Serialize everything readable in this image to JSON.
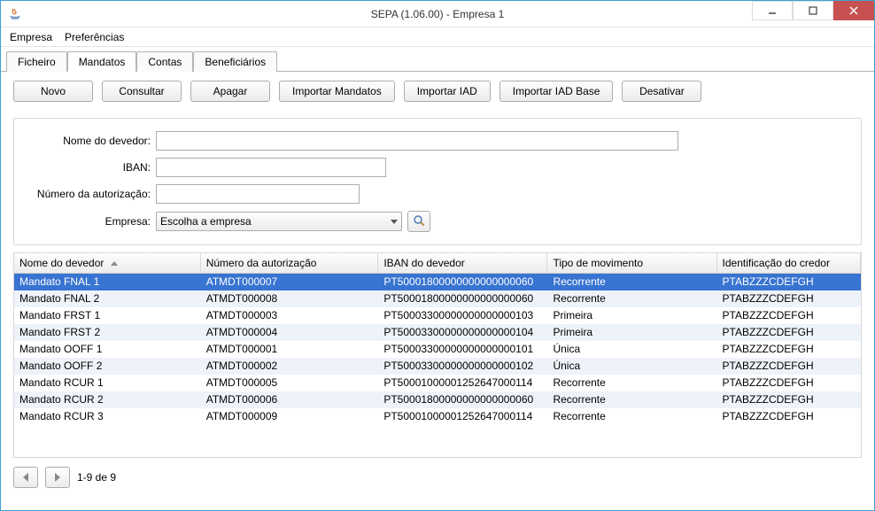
{
  "window": {
    "title": "SEPA  (1.06.00) - Empresa 1"
  },
  "menubar": {
    "empresa": "Empresa",
    "preferencias": "Preferências"
  },
  "tabs": {
    "ficheiro": "Ficheiro",
    "mandatos": "Mandatos",
    "contas": "Contas",
    "beneficiarios": "Beneficiários"
  },
  "toolbar": {
    "novo": "Novo",
    "consultar": "Consultar",
    "apagar": "Apagar",
    "importar_mandatos": "Importar Mandatos",
    "importar_iad": "Importar IAD",
    "importar_iad_base": "Importar IAD Base",
    "desativar": "Desativar"
  },
  "filters": {
    "nome_label": "Nome do devedor:",
    "iban_label": "IBAN:",
    "numero_label": "Número da autorização:",
    "empresa_label": "Empresa:",
    "empresa_placeholder": "Escolha a empresa",
    "nome_value": "",
    "iban_value": "",
    "numero_value": ""
  },
  "table": {
    "headers": {
      "nome": "Nome do devedor",
      "numero": "Número da autorização",
      "iban": "IBAN do devedor",
      "tipo": "Tipo de movimento",
      "credor": "Identificação do credor"
    },
    "rows": [
      {
        "nome": "Mandato FNAL 1",
        "numero": "ATMDT000007",
        "iban": "PT50001800000000000000060",
        "tipo": "Recorrente",
        "credor": "PTABZZZCDEFGH"
      },
      {
        "nome": "Mandato FNAL 2",
        "numero": "ATMDT000008",
        "iban": "PT50001800000000000000060",
        "tipo": "Recorrente",
        "credor": "PTABZZZCDEFGH"
      },
      {
        "nome": "Mandato FRST 1",
        "numero": "ATMDT000003",
        "iban": "PT50003300000000000000103",
        "tipo": "Primeira",
        "credor": "PTABZZZCDEFGH"
      },
      {
        "nome": "Mandato FRST 2",
        "numero": "ATMDT000004",
        "iban": "PT50003300000000000000104",
        "tipo": "Primeira",
        "credor": "PTABZZZCDEFGH"
      },
      {
        "nome": "Mandato OOFF 1",
        "numero": "ATMDT000001",
        "iban": "PT50003300000000000000101",
        "tipo": "Única",
        "credor": "PTABZZZCDEFGH"
      },
      {
        "nome": "Mandato OOFF 2",
        "numero": "ATMDT000002",
        "iban": "PT50003300000000000000102",
        "tipo": "Única",
        "credor": "PTABZZZCDEFGH"
      },
      {
        "nome": "Mandato RCUR 1",
        "numero": "ATMDT000005",
        "iban": "PT50001000001252647000114",
        "tipo": "Recorrente",
        "credor": "PTABZZZCDEFGH"
      },
      {
        "nome": "Mandato RCUR 2",
        "numero": "ATMDT000006",
        "iban": "PT50001800000000000000060",
        "tipo": "Recorrente",
        "credor": "PTABZZZCDEFGH"
      },
      {
        "nome": "Mandato RCUR 3",
        "numero": "ATMDT000009",
        "iban": "PT50001000001252647000114",
        "tipo": "Recorrente",
        "credor": "PTABZZZCDEFGH"
      }
    ],
    "selected_index": 0
  },
  "pager": {
    "status": "1-9 de 9"
  }
}
